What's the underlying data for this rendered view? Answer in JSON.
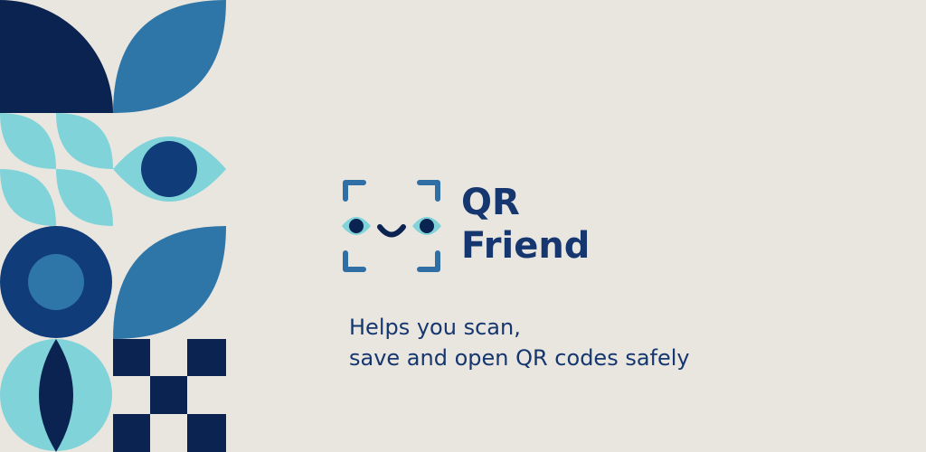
{
  "app": {
    "name_line1": "QR",
    "name_line2": "Friend",
    "tagline_line1": "Helps you scan,",
    "tagline_line2": "save and open QR codes safely"
  },
  "colors": {
    "background": "#e9e6e0",
    "navy": "#0b2350",
    "blue": "#2f76a8",
    "deep_blue": "#103c7a",
    "aqua": "#7fd3d9",
    "text": "#15366e",
    "logo_blue": "#2f6fa6"
  },
  "icons": {
    "logo": "qr-face-logo-icon"
  }
}
